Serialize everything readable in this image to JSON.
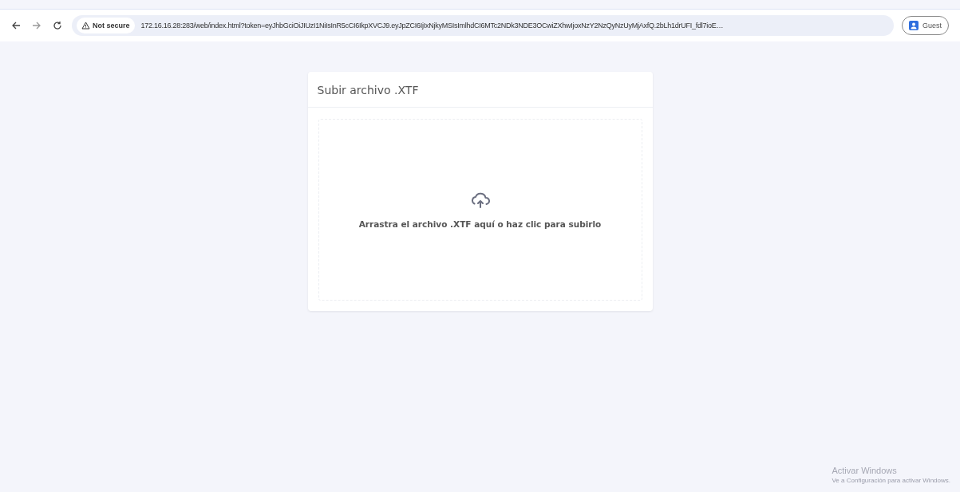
{
  "browser": {
    "security": "Not secure",
    "url": "172.16.16.28:283/web/index.html?token=eyJhbGciOiJIUzI1NiIsInR5cCI6IkpXVCJ9.eyJpZCI6IjIxNjkyMSIsImlhdCI6MTc2NDk3NDE3OCwiZXhwIjoxNzY2NzQyNzUyMjAxfQ.2bLh1drUFI_fdl7ioE…",
    "profile": "Guest"
  },
  "card": {
    "title": "Subir archivo .XTF",
    "dropzone": {
      "text": "Arrastra el archivo .XTF aquí o haz clic para subirlo"
    }
  },
  "os_notice": {
    "title": "Activar Windows",
    "subtitle": "Ve a Configuración para activar Windows."
  }
}
